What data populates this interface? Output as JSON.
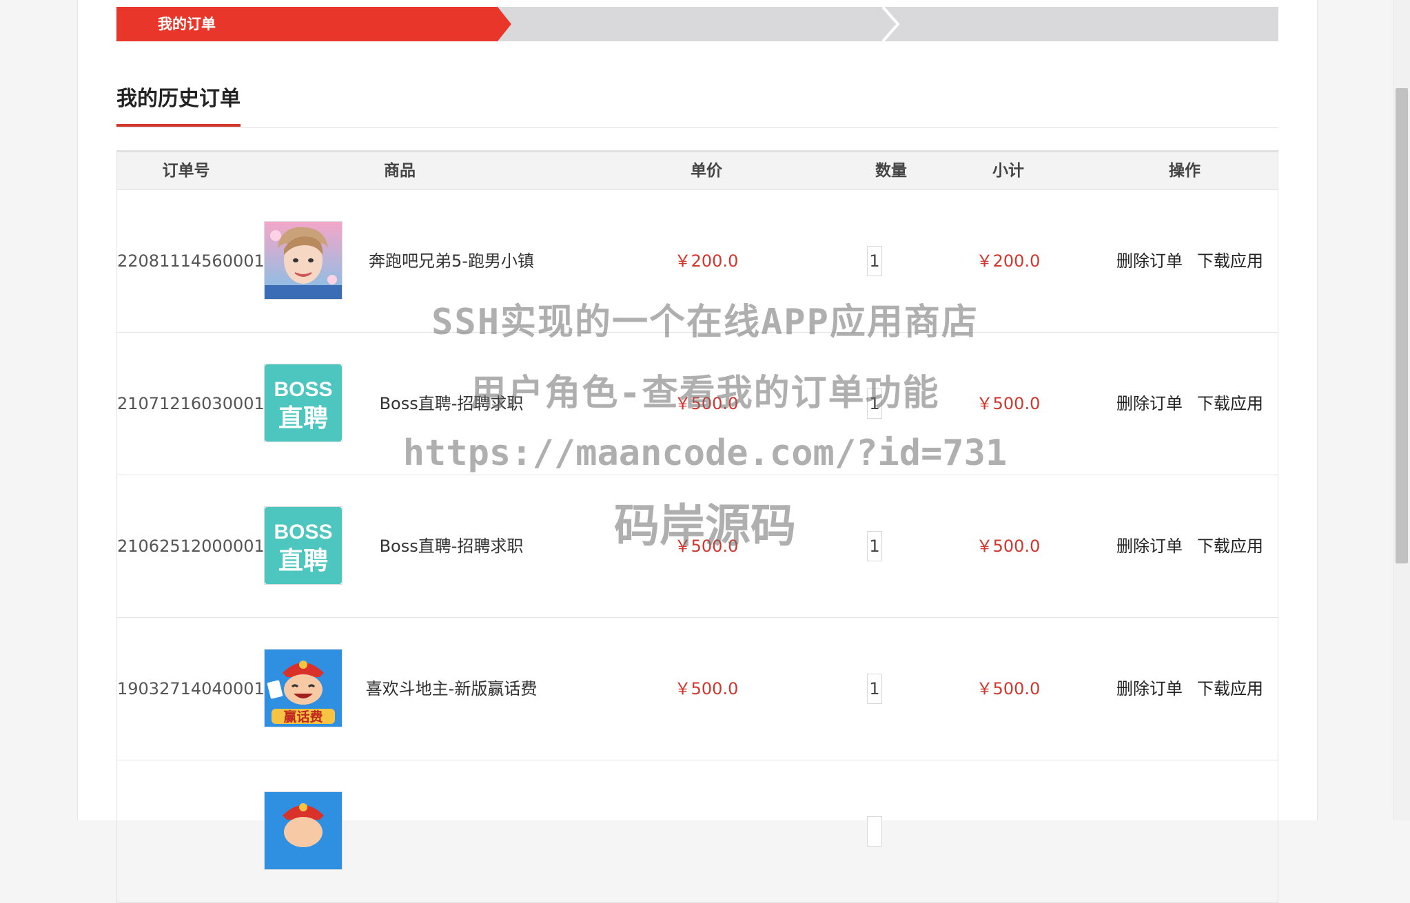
{
  "steps": {
    "active_label": "我的订单",
    "colors": {
      "active": "#e8372a",
      "inactive": "#d9d9dc"
    }
  },
  "section": {
    "title": "我的历史订单"
  },
  "table": {
    "headers": {
      "order_no": "订单号",
      "product": "商品",
      "unit_price": "单价",
      "quantity": "数量",
      "subtotal": "小计",
      "actions": "操作"
    },
    "rows": [
      {
        "order_no": "22081114560001",
        "icon": "running-man-game-icon",
        "name": "奔跑吧兄弟5-跑男小镇",
        "price": "￥200.0",
        "qty": "1",
        "subtotal": "￥200.0",
        "delete": "删除订单",
        "download": "下载应用"
      },
      {
        "order_no": "21071216030001",
        "icon": "boss-zhipin-icon",
        "name": "Boss直聘-招聘求职",
        "price": "￥500.0",
        "qty": "1",
        "subtotal": "￥500.0",
        "delete": "删除订单",
        "download": "下载应用"
      },
      {
        "order_no": "21062512000001",
        "icon": "boss-zhipin-icon",
        "name": "Boss直聘-招聘求职",
        "price": "￥500.0",
        "qty": "1",
        "subtotal": "￥500.0",
        "delete": "删除订单",
        "download": "下载应用"
      },
      {
        "order_no": "19032714040001",
        "icon": "doudizhu-game-icon",
        "name": "喜欢斗地主-新版赢话费",
        "price": "￥500.0",
        "qty": "1",
        "subtotal": "￥500.0",
        "delete": "删除订单",
        "download": "下载应用"
      },
      {
        "order_no": "",
        "icon": "doudizhu-game-icon",
        "name": "",
        "price": "",
        "qty": "",
        "subtotal": "",
        "delete": "",
        "download": ""
      }
    ]
  },
  "icon_text": {
    "boss_line1": "BOSS",
    "boss_line2": "直聘",
    "doudizhu_banner": "赢话费"
  },
  "watermark": {
    "line1": "SSH实现的一个在线APP应用商店",
    "line2": "用户角色-查看我的订单功能",
    "line3": "https://maancode.com/?id=731",
    "line4": "码岸源码"
  }
}
